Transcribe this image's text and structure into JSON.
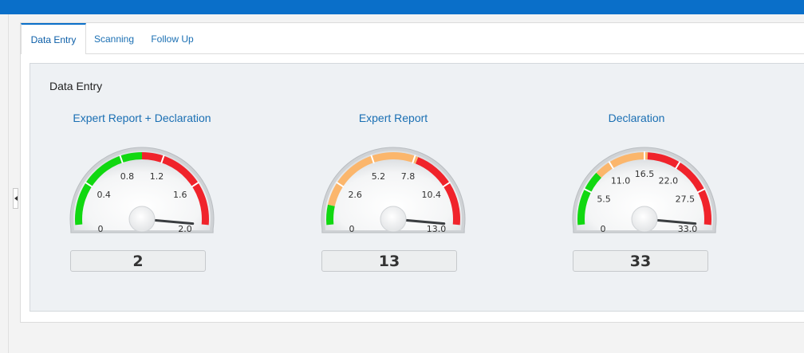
{
  "tabs": [
    {
      "label": "Data Entry",
      "active": true
    },
    {
      "label": "Scanning",
      "active": false
    },
    {
      "label": "Follow Up",
      "active": false
    }
  ],
  "section_title": "Data Entry",
  "colors": {
    "top_bar": "#0a6fc9",
    "green": "#11d811",
    "orange": "#fbb66c",
    "red": "#f0232b",
    "title_blue": "#1a6fb3"
  },
  "gauges": [
    {
      "title": "Expert Report + Declaration",
      "min": 0,
      "max": 2.0,
      "value": 2,
      "display_value": "2",
      "tick_labels": [
        "0",
        "0.4",
        "0.8",
        "1.2",
        "1.6",
        "2.0"
      ],
      "bands": [
        {
          "from": 0,
          "to": 1.0,
          "color": "green"
        },
        {
          "from": 1.0,
          "to": 2.0,
          "color": "red"
        }
      ]
    },
    {
      "title": "Expert Report",
      "min": 0,
      "max": 13.0,
      "value": 13,
      "display_value": "13",
      "tick_labels": [
        "0",
        "2.6",
        "5.2",
        "7.8",
        "10.4",
        "13.0"
      ],
      "bands": [
        {
          "from": 0,
          "to": 1.2,
          "color": "green"
        },
        {
          "from": 1.2,
          "to": 8.0,
          "color": "orange"
        },
        {
          "from": 8.0,
          "to": 13.0,
          "color": "red"
        }
      ]
    },
    {
      "title": "Declaration",
      "min": 0,
      "max": 33.0,
      "value": 33,
      "display_value": "33",
      "tick_labels": [
        "0",
        "5.5",
        "11.0",
        "16.5",
        "22.0",
        "27.5",
        "33.0"
      ],
      "bands": [
        {
          "from": 0,
          "to": 8.5,
          "color": "green"
        },
        {
          "from": 8.5,
          "to": 17.0,
          "color": "orange"
        },
        {
          "from": 17.0,
          "to": 33.0,
          "color": "red"
        }
      ]
    }
  ]
}
